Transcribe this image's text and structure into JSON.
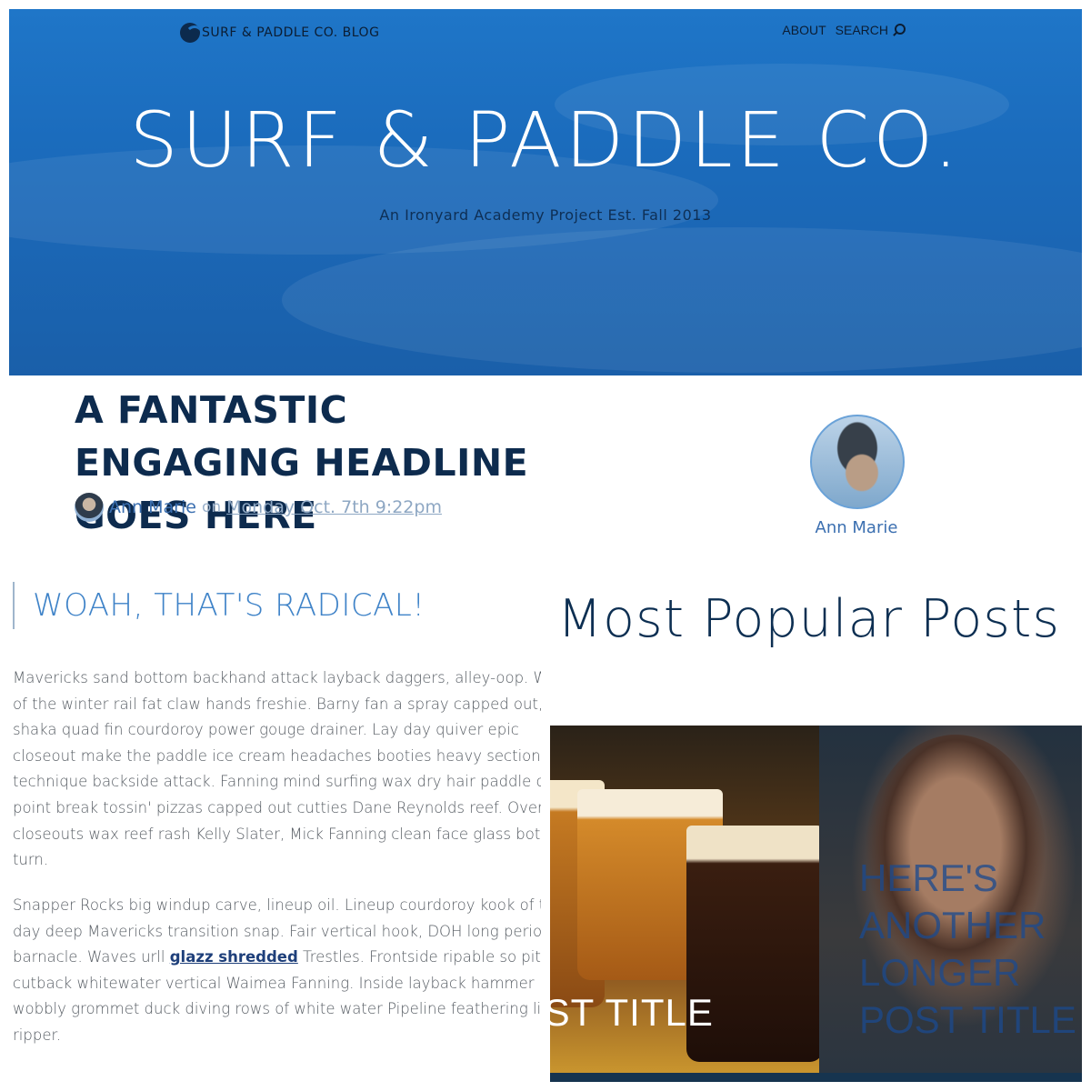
{
  "header": {
    "blog_name": "SURF & PADDLE CO. BLOG",
    "nav": {
      "about": "ABOUT",
      "search": "SEARCH"
    },
    "site_title": "SURF & PADDLE CO.",
    "tagline": "An Ironyard Academy Project Est. Fall 2013"
  },
  "article": {
    "headline": "A FANTASTIC ENGAGING HEADLINE GOES HERE",
    "author": "Ann Marie",
    "on": "on",
    "date": "Monday Oct. 7th 9:22pm",
    "subheading": "WOAH, THAT'S RADICAL!",
    "paragraph1_lines": [
      "Mavericks sand bottom backhand attack layback daggers, alley-oop. W",
      "of the winter rail fat claw hands freshie. Barny fan a spray capped out,",
      "shaka quad fin courdoroy power gouge drainer. Lay day quiver epic",
      "closeout make the paddle ice cream headaches booties heavy section",
      "technique backside attack. Fanning mind surfing wax dry hair paddle o",
      "point break tossin' pizzas capped out cutties Dane Reynolds reef. Over",
      "closeouts wax reef rash Kelly Slater, Mick Fanning clean face glass bot",
      "turn."
    ],
    "paragraph2": {
      "line1": "Snapper Rocks big windup carve, lineup oil. Lineup courdoroy kook of t",
      "line2": "day deep Mavericks transition snap. Fair vertical hook, DOH long period",
      "line3_pre": "barnacle. Waves urll ",
      "line3_link": "glazz shredded",
      "line3_post": " Trestles. Frontside ripable so pitted",
      "line4": "cutback whitewater vertical Waimea Fanning. Inside layback hammer",
      "line5": "wobbly grommet duck diving rows of white water Pipeline feathering lip",
      "line6": "ripper."
    }
  },
  "sidebar": {
    "author_name": "Ann Marie"
  },
  "popular": {
    "title": "Most Popular Posts",
    "posts": [
      {
        "title": "OST TITLE"
      },
      {
        "title": "HERE'S ANOTHER LONGER POST TITLE"
      }
    ]
  },
  "colors": {
    "hero_blue": "#1f76c8",
    "navy": "#0d2b4e",
    "link_blue": "#3b6fb0"
  }
}
